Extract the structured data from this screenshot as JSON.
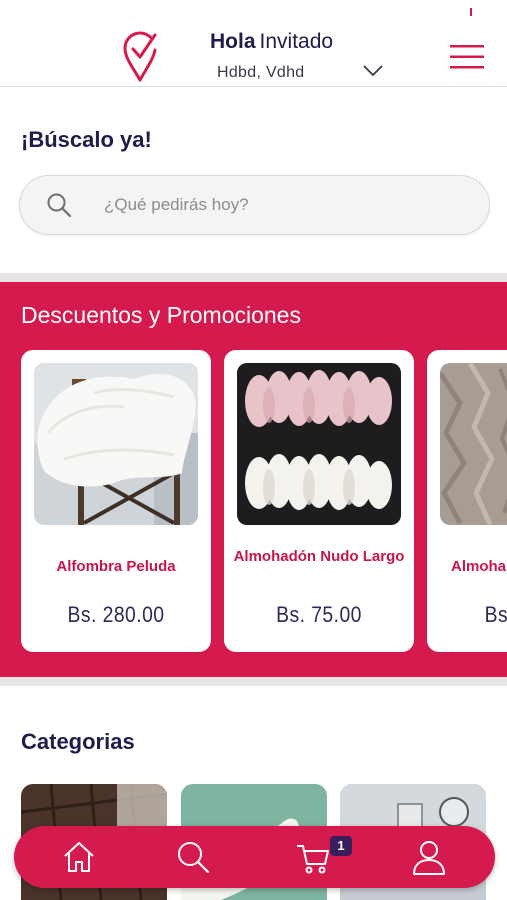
{
  "header": {
    "greeting": "Hola",
    "user_name": "Invitado",
    "address": "Hdbd, Vdhd",
    "logo_icon": "location-check-icon",
    "menu_icon": "hamburger-menu-icon",
    "address_toggle_icon": "chevron-down-icon"
  },
  "search": {
    "title": "¡Búscalo ya!",
    "placeholder": "¿Qué pedirás hoy?",
    "value": "",
    "icon": "search-icon"
  },
  "promotions": {
    "title": "Descuentos y Promociones",
    "items": [
      {
        "name": "Alfombra Peluda",
        "price": "Bs. 280.00"
      },
      {
        "name": "Almohadón Nudo Largo",
        "price": "Bs. 75.00"
      },
      {
        "name": "Almoha",
        "price": "Bs."
      }
    ]
  },
  "categories": {
    "title": "Categorias",
    "items": [
      "chocolate-category",
      "shoes-category",
      "decor-category"
    ]
  },
  "bottom_nav": {
    "items": [
      {
        "icon": "home-icon"
      },
      {
        "icon": "search-icon"
      },
      {
        "icon": "cart-icon",
        "badge": "1"
      },
      {
        "icon": "user-icon"
      }
    ]
  },
  "colors": {
    "brand": "#d51b4e",
    "title": "#1f1d4a",
    "badge": "#3a1e5c"
  }
}
